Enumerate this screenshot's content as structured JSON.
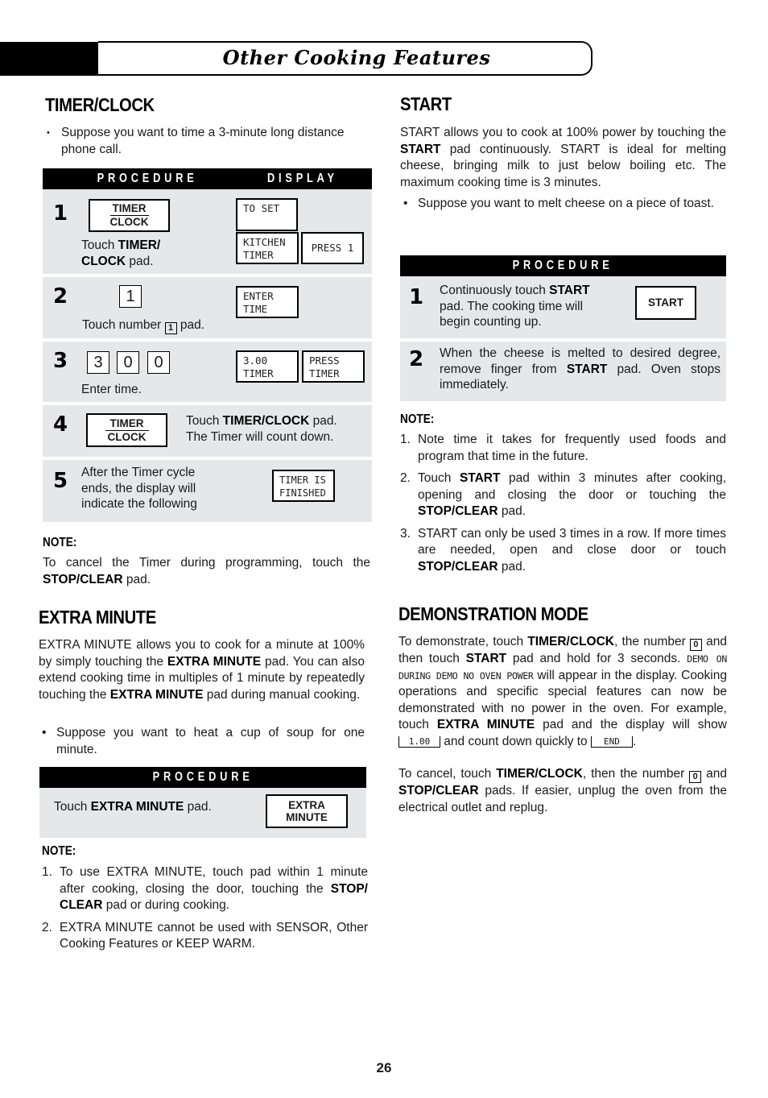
{
  "header": {
    "title": "Other Cooking Features"
  },
  "timer_clock": {
    "heading": "TIMER/CLOCK",
    "bullet": "Suppose you want to time a 3-minute long distance phone call.",
    "table_headers": {
      "procedure": "PROCEDURE",
      "display": "DISPLAY"
    },
    "steps": [
      {
        "num": "1",
        "pad_top": "TIMER",
        "pad_bottom": "CLOCK",
        "text_pre": "Touch ",
        "text_bold": "TIMER/ CLOCK",
        "text_post": " pad.",
        "displays": [
          "TO SET",
          "KITCHEN\nTIMER",
          "PRESS 1"
        ]
      },
      {
        "num": "2",
        "key": "1",
        "text_pre": "Touch number ",
        "inline_key": "1",
        "text_post": " pad.",
        "displays": [
          "ENTER\nTIME"
        ]
      },
      {
        "num": "3",
        "keys": [
          "3",
          "0",
          "0"
        ],
        "text": "Enter time.",
        "displays": [
          "3.00\nTIMER",
          "PRESS\nTIMER"
        ]
      },
      {
        "num": "4",
        "pad_top": "TIMER",
        "pad_bottom": "CLOCK",
        "text_pre": "Touch ",
        "text_bold": "TIMER/CLOCK",
        "text_post": " pad.",
        "text_line2": "The Timer will count down."
      },
      {
        "num": "5",
        "text": "After the Timer cycle ends, the display will indicate the following",
        "displays": [
          "TIMER IS\nFINISHED"
        ]
      }
    ],
    "note_heading": "NOTE:",
    "note_pre": "To cancel the Timer during programming, touch the ",
    "note_bold": "STOP/CLEAR",
    "note_post": " pad."
  },
  "extra_minute": {
    "heading": "EXTRA MINUTE",
    "para_1": "EXTRA MINUTE allows you to cook for a minute at 100% by simply touching the ",
    "para_bold_1": "EXTRA MINUTE",
    "para_2": " pad. You can also extend cooking time in multiples of 1 minute by repeatedly touching the ",
    "para_bold_2": "EXTRA MINUTE",
    "para_3": " pad during manual cooking.",
    "bullet": "Suppose you want to heat a cup of soup for one minute.",
    "procedure_header": "PROCEDURE",
    "step_pre": "Touch ",
    "step_bold": "EXTRA MINUTE",
    "step_post": " pad.",
    "pad_line1": "EXTRA",
    "pad_line2": "MINUTE",
    "note_heading": "NOTE:",
    "notes": [
      {
        "n": "1.",
        "pre": "To use EXTRA MINUTE, touch pad within 1 minute after cooking, closing the door, touching the ",
        "bold": "STOP/ CLEAR",
        "post": " pad or during cooking."
      },
      {
        "n": "2.",
        "pre": "EXTRA MINUTE cannot be used with SENSOR, Other Cooking Features or KEEP WARM.",
        "bold": "",
        "post": ""
      }
    ]
  },
  "start": {
    "heading": "START",
    "para_1": "START allows you to cook at 100% power by  touching the ",
    "para_bold": "START",
    "para_2": " pad continuously. START is ideal for melting cheese, bringing milk to just below boiling etc. The maximum cooking time is 3 minutes.",
    "bullet": "Suppose you want to melt cheese on a piece of toast.",
    "procedure_header": "PROCEDURE",
    "steps": [
      {
        "num": "1",
        "pre": "Continuously touch ",
        "bold": "START",
        "post": " pad. The cooking time will begin counting up.",
        "pad": "START"
      },
      {
        "num": "2",
        "pre": "When the cheese is melted to desired degree, remove finger from ",
        "bold": "START",
        "post": " pad. Oven stops immediately."
      }
    ],
    "note_heading": "NOTE:",
    "notes": [
      {
        "n": "1.",
        "pre": "Note time it takes for frequently used foods and program that time in the future.",
        "bold": "",
        "post": ""
      },
      {
        "n": "2.",
        "pre": "Touch ",
        "bold": "START",
        "post": " pad within 3 minutes after cooking, opening and closing the door or touching the ",
        "bold2": "STOP/CLEAR",
        "post2": " pad."
      },
      {
        "n": "3.",
        "pre": "START can only be used 3 times in a row. If more times are needed, open and close door or touch ",
        "bold": "STOP/CLEAR",
        "post": " pad."
      }
    ]
  },
  "demo": {
    "heading": "DEMONSTRATION MODE",
    "p1_a": "To demonstrate, touch ",
    "p1_b": "TIMER/CLOCK",
    "p1_c": ", the number ",
    "key_0": "0",
    "p1_d": " and then touch ",
    "p1_e": "START",
    "p1_f": " pad and hold for 3 seconds. ",
    "lcd_text": "DEMO ON DURING DEMO NO OVEN POWER",
    "p1_g": " will appear in the display. Cooking operations and specific special features can now be demonstrated with no power in the oven. For example, touch ",
    "p1_h": "EXTRA MINUTE",
    "p1_i": " pad and the display will show ",
    "lcd_1": "1.00",
    "p1_j": " and count down quickly to ",
    "lcd_2": "END",
    "p1_k": ".",
    "p2_a": "To cancel, touch ",
    "p2_b": "TIMER/CLOCK",
    "p2_c": ", then the number ",
    "p2_d": " and ",
    "p2_e": "STOP/CLEAR",
    "p2_f": " pads. If easier, unplug the oven from the electrical outlet and replug."
  },
  "footer": {
    "page_number": "26"
  }
}
